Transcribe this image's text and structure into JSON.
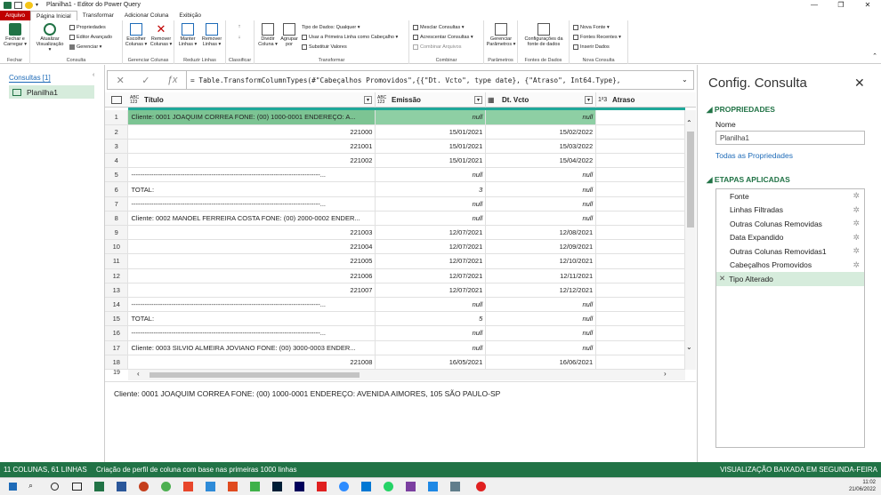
{
  "window": {
    "title": "Planilha1 - Editor do Power Query",
    "min": "—",
    "max": "❐",
    "close": "✕"
  },
  "tabs": [
    {
      "label": "Arquivo"
    },
    {
      "label": "Página Inicial"
    },
    {
      "label": "Transformar"
    },
    {
      "label": "Adicionar Coluna"
    },
    {
      "label": "Exibição"
    }
  ],
  "ribbon": {
    "close_load": "Fechar e Carregar ▾",
    "refresh": "Atualizar Visualização ▾",
    "properties": "Propriedades",
    "adv_editor": "Editor Avançado",
    "manage": "Gerenciar ▾",
    "choose_cols": "Escolher Colunas ▾",
    "remove_cols": "Remover Colunas ▾",
    "keep_rows": "Manter Linhas ▾",
    "remove_rows": "Remover Linhas ▾",
    "split_col": "Dividir Coluna ▾",
    "group_by": "Agrupar por",
    "data_type": "Tipo de Dados: Qualquer ▾",
    "use_first_row": "Usar a Primeira Linha como Cabeçalho ▾",
    "replace_values": "Substituir Valores",
    "merge_queries": "Mesclar Consultas ▾",
    "append_queries": "Acrescentar Consultas ▾",
    "combine_files": "Combinar Arquivos",
    "manage_params": "Gerenciar Parâmetros ▾",
    "ds_settings": "Configurações da fonte de dados",
    "new_source": "Nova Fonte ▾",
    "recent_sources": "Fontes Recentes ▾",
    "enter_data": "Inserir Dados",
    "groups": {
      "fechar": "Fechar",
      "consulta": "Consulta",
      "gerenciar_colunas": "Gerenciar Colunas",
      "reduzir_linhas": "Reduzir Linhas",
      "classificar": "Classificar",
      "transformar": "Transformar",
      "combinar": "Combinar",
      "parametros": "Parâmetros",
      "fontes": "Fontes de Dados",
      "nova_consulta": "Nova Consulta"
    }
  },
  "queries": {
    "header": "Consultas [1]",
    "items": [
      {
        "label": "Planilha1"
      }
    ]
  },
  "formula": "= Table.TransformColumnTypes(#\"Cabeçalhos Promovidos\",{{\"Dt. Vcto\", type date}, {\"Atraso\", Int64.Type},",
  "columns": [
    {
      "type": "ABC 123",
      "name": "Título"
    },
    {
      "type": "ABC 123",
      "name": "Emissão"
    },
    {
      "type": "▦",
      "name": "Dt. Vcto"
    },
    {
      "type": "1²3",
      "name": "Atraso"
    }
  ],
  "rows": [
    {
      "n": "1",
      "a": "Cliente: 0001 JOAQUIM CORREA FONE: (00) 1000-0001  ENDEREÇO: A...",
      "b": "null",
      "c": "null"
    },
    {
      "n": "2",
      "a": "221000",
      "b": "15/01/2021",
      "c": "15/02/2022"
    },
    {
      "n": "3",
      "a": "221001",
      "b": "15/01/2021",
      "c": "15/03/2022"
    },
    {
      "n": "4",
      "a": "221002",
      "b": "15/01/2021",
      "c": "15/04/2022"
    },
    {
      "n": "5",
      "a": "-------------------------------------------------------------------------------------...",
      "b": "null",
      "c": "null"
    },
    {
      "n": "6",
      "a": "TOTAL:",
      "b": "3",
      "c": "null"
    },
    {
      "n": "7",
      "a": "-------------------------------------------------------------------------------------...",
      "b": "null",
      "c": "null"
    },
    {
      "n": "8",
      "a": "Cliente: 0002 MANOEL FERREIRA COSTA FONE: (00) 2000-0002  ENDER...",
      "b": "null",
      "c": "null"
    },
    {
      "n": "9",
      "a": "221003",
      "b": "12/07/2021",
      "c": "12/08/2021"
    },
    {
      "n": "10",
      "a": "221004",
      "b": "12/07/2021",
      "c": "12/09/2021"
    },
    {
      "n": "11",
      "a": "221005",
      "b": "12/07/2021",
      "c": "12/10/2021"
    },
    {
      "n": "12",
      "a": "221006",
      "b": "12/07/2021",
      "c": "12/11/2021"
    },
    {
      "n": "13",
      "a": "221007",
      "b": "12/07/2021",
      "c": "12/12/2021"
    },
    {
      "n": "14",
      "a": "-------------------------------------------------------------------------------------...",
      "b": "null",
      "c": "null"
    },
    {
      "n": "15",
      "a": "TOTAL:",
      "b": "5",
      "c": "null"
    },
    {
      "n": "16",
      "a": "-------------------------------------------------------------------------------------...",
      "b": "null",
      "c": "null"
    },
    {
      "n": "17",
      "a": "Cliente: 0003 SILVIO ALMEIRA JOVIANO FONE: (00) 3000-0003  ENDER...",
      "b": "null",
      "c": "null"
    },
    {
      "n": "18",
      "a": "221008",
      "b": "16/05/2021",
      "c": "16/06/2021"
    },
    {
      "n": "19",
      "a": "",
      "b": "",
      "c": ""
    }
  ],
  "preview_text": "Cliente: 0001 JOAQUIM CORREA FONE: (00) 1000-0001  ENDEREÇO: AVENIDA AIMORES, 105  SÃO PAULO-SP",
  "settings": {
    "title": "Config. Consulta",
    "props_header": "PROPRIEDADES",
    "name_label": "Nome",
    "name_value": "Planilha1",
    "all_props": "Todas as Propriedades",
    "steps_header": "ETAPAS APLICADAS",
    "steps": [
      {
        "label": "Fonte"
      },
      {
        "label": "Linhas Filtradas"
      },
      {
        "label": "Outras Colunas Removidas"
      },
      {
        "label": "Data Expandido"
      },
      {
        "label": "Outras Colunas Removidas1"
      },
      {
        "label": "Cabeçalhos Promovidos"
      },
      {
        "label": "Tipo Alterado"
      }
    ]
  },
  "status": {
    "left": "11 COLUNAS, 61 LINHAS",
    "profile": "Criação de perfil de coluna com base nas primeiras 1000 linhas",
    "right": "VISUALIZAÇÃO BAIXADA EM SEGUNDA-FEIRA"
  },
  "clock": {
    "time": "11:02",
    "date": "21/06/2022"
  },
  "colors": {
    "accent_green": "#217346",
    "file_tab": "#c00000",
    "selected_row": "#8ecfa4",
    "quality_bar": "#1fa89a",
    "link": "#1e6bb8"
  }
}
